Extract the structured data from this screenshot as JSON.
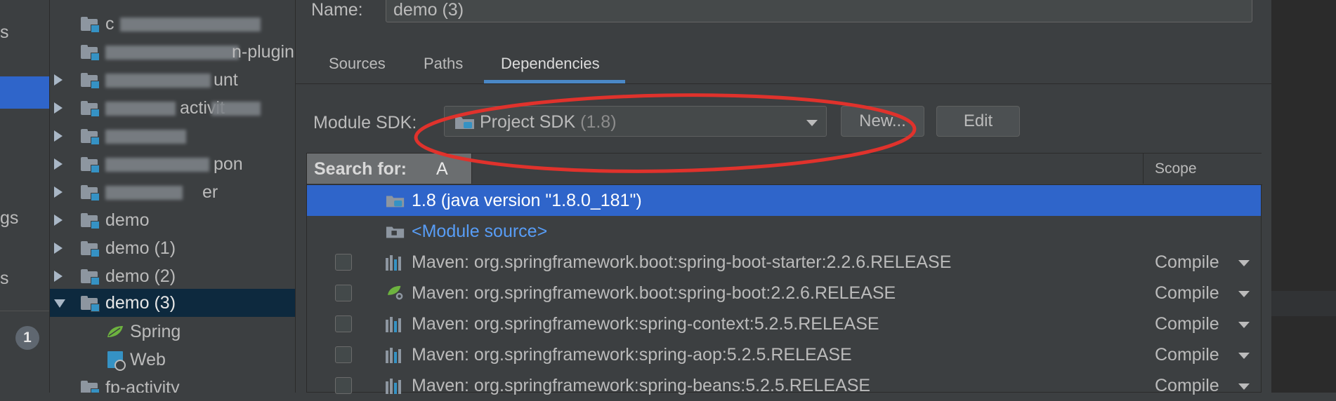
{
  "left_strip": {
    "fragments": [
      "s",
      "gs",
      "s"
    ],
    "badge": "1"
  },
  "tree": {
    "items": [
      {
        "label": "c",
        "visible_suffix": "",
        "blurred": true,
        "expandable": false
      },
      {
        "label": "",
        "visible_suffix": "n-plugin-s",
        "blurred": true,
        "expandable": false
      },
      {
        "label": "",
        "visible_suffix": "unt",
        "blurred": true,
        "expandable": true
      },
      {
        "label": "",
        "visible_suffix": "activit",
        "blurred": true,
        "expandable": true
      },
      {
        "label": "",
        "visible_suffix": "",
        "blurred": true,
        "expandable": true
      },
      {
        "label": "",
        "visible_suffix": "pon",
        "blurred": true,
        "expandable": true
      },
      {
        "label": "",
        "visible_suffix": "er",
        "blurred": true,
        "expandable": true
      },
      {
        "label": "demo",
        "expandable": true
      },
      {
        "label": "demo (1)",
        "expandable": true
      },
      {
        "label": "demo (2)",
        "expandable": true
      },
      {
        "label": "demo (3)",
        "expandable": true,
        "expanded": true,
        "selected": true
      },
      {
        "label": "Spring",
        "child": true,
        "icon": "spring-leaf-icon"
      },
      {
        "label": "Web",
        "child": true,
        "icon": "web-icon"
      },
      {
        "label": "fp-activity",
        "expandable": false
      }
    ]
  },
  "panel": {
    "name_label": "Name:",
    "name_value": "demo (3)",
    "tabs": [
      "Sources",
      "Paths",
      "Dependencies"
    ],
    "active_tab": "Dependencies",
    "module_sdk_label": "Module SDK:",
    "sdk_value": "Project SDK",
    "sdk_version": "(1.8)",
    "new_button": "New...",
    "edit_button": "Edit",
    "search_label": "Search for:",
    "search_query": "A",
    "scope_header": "Scope"
  },
  "dependencies": [
    {
      "text": "1.8 (java version \"1.8.0_181\")",
      "icon": "jdk-folder-icon",
      "selected": true,
      "checkbox": false,
      "scope": ""
    },
    {
      "text": "<Module source>",
      "icon": "module-source-icon",
      "checkbox": false,
      "link": true,
      "scope": ""
    },
    {
      "text": "Maven: org.springframework.boot:spring-boot-starter:2.2.6.RELEASE",
      "icon": "library-icon",
      "checkbox": true,
      "scope": "Compile"
    },
    {
      "text": "Maven: org.springframework.boot:spring-boot:2.2.6.RELEASE",
      "icon": "spring-boot-icon",
      "checkbox": true,
      "scope": "Compile"
    },
    {
      "text": "Maven: org.springframework:spring-context:5.2.5.RELEASE",
      "icon": "library-icon",
      "checkbox": true,
      "scope": "Compile"
    },
    {
      "text": "Maven: org.springframework:spring-aop:5.2.5.RELEASE",
      "icon": "library-icon",
      "checkbox": true,
      "scope": "Compile"
    },
    {
      "text": "Maven: org.springframework:spring-beans:5.2.5.RELEASE",
      "icon": "library-icon",
      "checkbox": true,
      "scope": "Compile"
    }
  ],
  "colors": {
    "selection": "#2f65ca",
    "tree_selection": "#0d293e",
    "annotation": "#e0322c",
    "link": "#589df6"
  }
}
